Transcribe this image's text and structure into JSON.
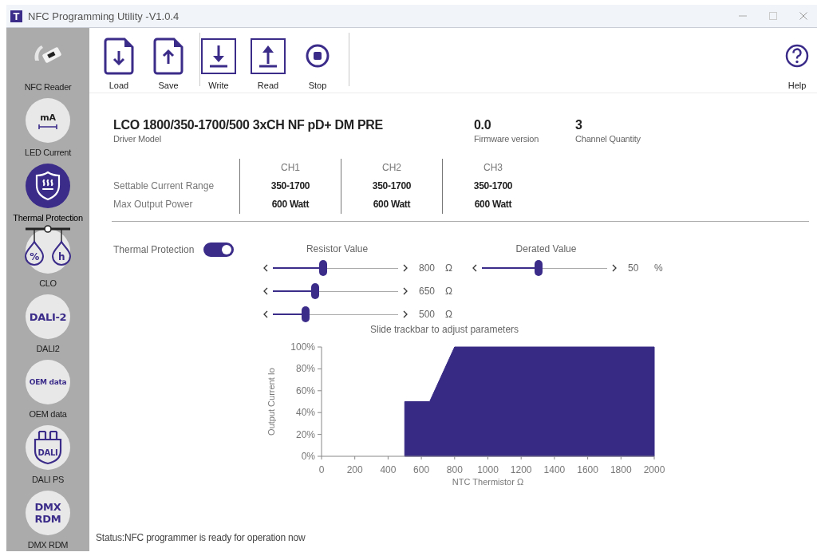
{
  "window": {
    "app_icon_letter": "T",
    "title": "NFC Programming Utility -V1.0.4"
  },
  "toolbar": {
    "groups": [
      [
        {
          "label": "Load",
          "kind": "load"
        },
        {
          "label": "Save",
          "kind": "save"
        }
      ],
      [
        {
          "label": "Write",
          "kind": "write"
        },
        {
          "label": "Read",
          "kind": "read"
        },
        {
          "label": "Stop",
          "kind": "stop"
        }
      ]
    ],
    "help": {
      "label": "Help"
    }
  },
  "sidebar": {
    "items": [
      {
        "label": "NFC Reader",
        "kind": "reader",
        "selected": false
      },
      {
        "label": "LED Current",
        "kind": "current",
        "icon_texts": [
          "mA"
        ],
        "selected": false
      },
      {
        "label": "Thermal Protection",
        "kind": "thermal",
        "selected": true
      },
      {
        "label": "CLO",
        "kind": "clo",
        "icon_texts": [
          "%",
          "h"
        ],
        "selected": false
      },
      {
        "label": "DALI2",
        "kind": "text",
        "icon_texts": [
          "DALI-2"
        ],
        "selected": false
      },
      {
        "label": "OEM data",
        "kind": "text",
        "icon_texts": [
          "OEM data"
        ],
        "selected": false
      },
      {
        "label": "DALI PS",
        "kind": "plug",
        "icon_texts": [
          "DALI"
        ],
        "selected": false
      },
      {
        "label": "DMX RDM",
        "kind": "text",
        "icon_texts": [
          "DMX",
          "RDM"
        ],
        "selected": false
      }
    ]
  },
  "device": {
    "model": "LCO 1800/350-1700/500 3xCH NF pD+ DM PRE",
    "model_label": "Driver Model",
    "firmware": "0.0",
    "firmware_label": "Firmware version",
    "channel_quantity": "3",
    "channel_quantity_label": "Channel Quantity"
  },
  "spec_table": {
    "row_labels": [
      "Settable Current Range",
      "Max Output Power"
    ],
    "channels": [
      {
        "name": "CH1",
        "current_range": "350-1700",
        "max_power": "600 Watt"
      },
      {
        "name": "CH2",
        "current_range": "350-1700",
        "max_power": "600 Watt"
      },
      {
        "name": "CH3",
        "current_range": "350-1700",
        "max_power": "600 Watt"
      }
    ]
  },
  "thermal": {
    "label": "Thermal Protection",
    "on": true,
    "resistor": {
      "heading": "Resistor Value",
      "sliders": [
        {
          "level": 0.4,
          "value": "800",
          "unit": "Ω"
        },
        {
          "level": 0.34,
          "value": "650",
          "unit": "Ω"
        },
        {
          "level": 0.26,
          "value": "500",
          "unit": "Ω"
        }
      ]
    },
    "derated": {
      "heading": "Derated Value",
      "slider": {
        "level": 0.45,
        "value": "50",
        "unit": "%"
      }
    },
    "hint": "Slide trackbar to adjust parameters",
    "chart_data": {
      "type": "area",
      "xlabel": "NTC Thermistor Ω",
      "ylabel": "Output Current Io",
      "x": [
        500,
        500,
        650,
        800,
        2000
      ],
      "series": [
        {
          "color": "#372a85",
          "values": [
            0,
            50,
            50,
            100,
            100
          ]
        }
      ],
      "xlim": [
        0,
        2000
      ],
      "ylim": [
        0,
        100
      ],
      "xticks": [
        0,
        200,
        400,
        600,
        800,
        1000,
        1200,
        1400,
        1600,
        1800,
        2000
      ],
      "yticks": [
        {
          "value": 0,
          "label": "0%"
        },
        {
          "value": 20,
          "label": "20%"
        },
        {
          "value": 40,
          "label": "40%"
        },
        {
          "value": 60,
          "label": "60%"
        },
        {
          "value": 80,
          "label": "80%"
        },
        {
          "value": 100,
          "label": "100%"
        }
      ]
    }
  },
  "status": "Status:NFC programmer is ready for operation now"
}
